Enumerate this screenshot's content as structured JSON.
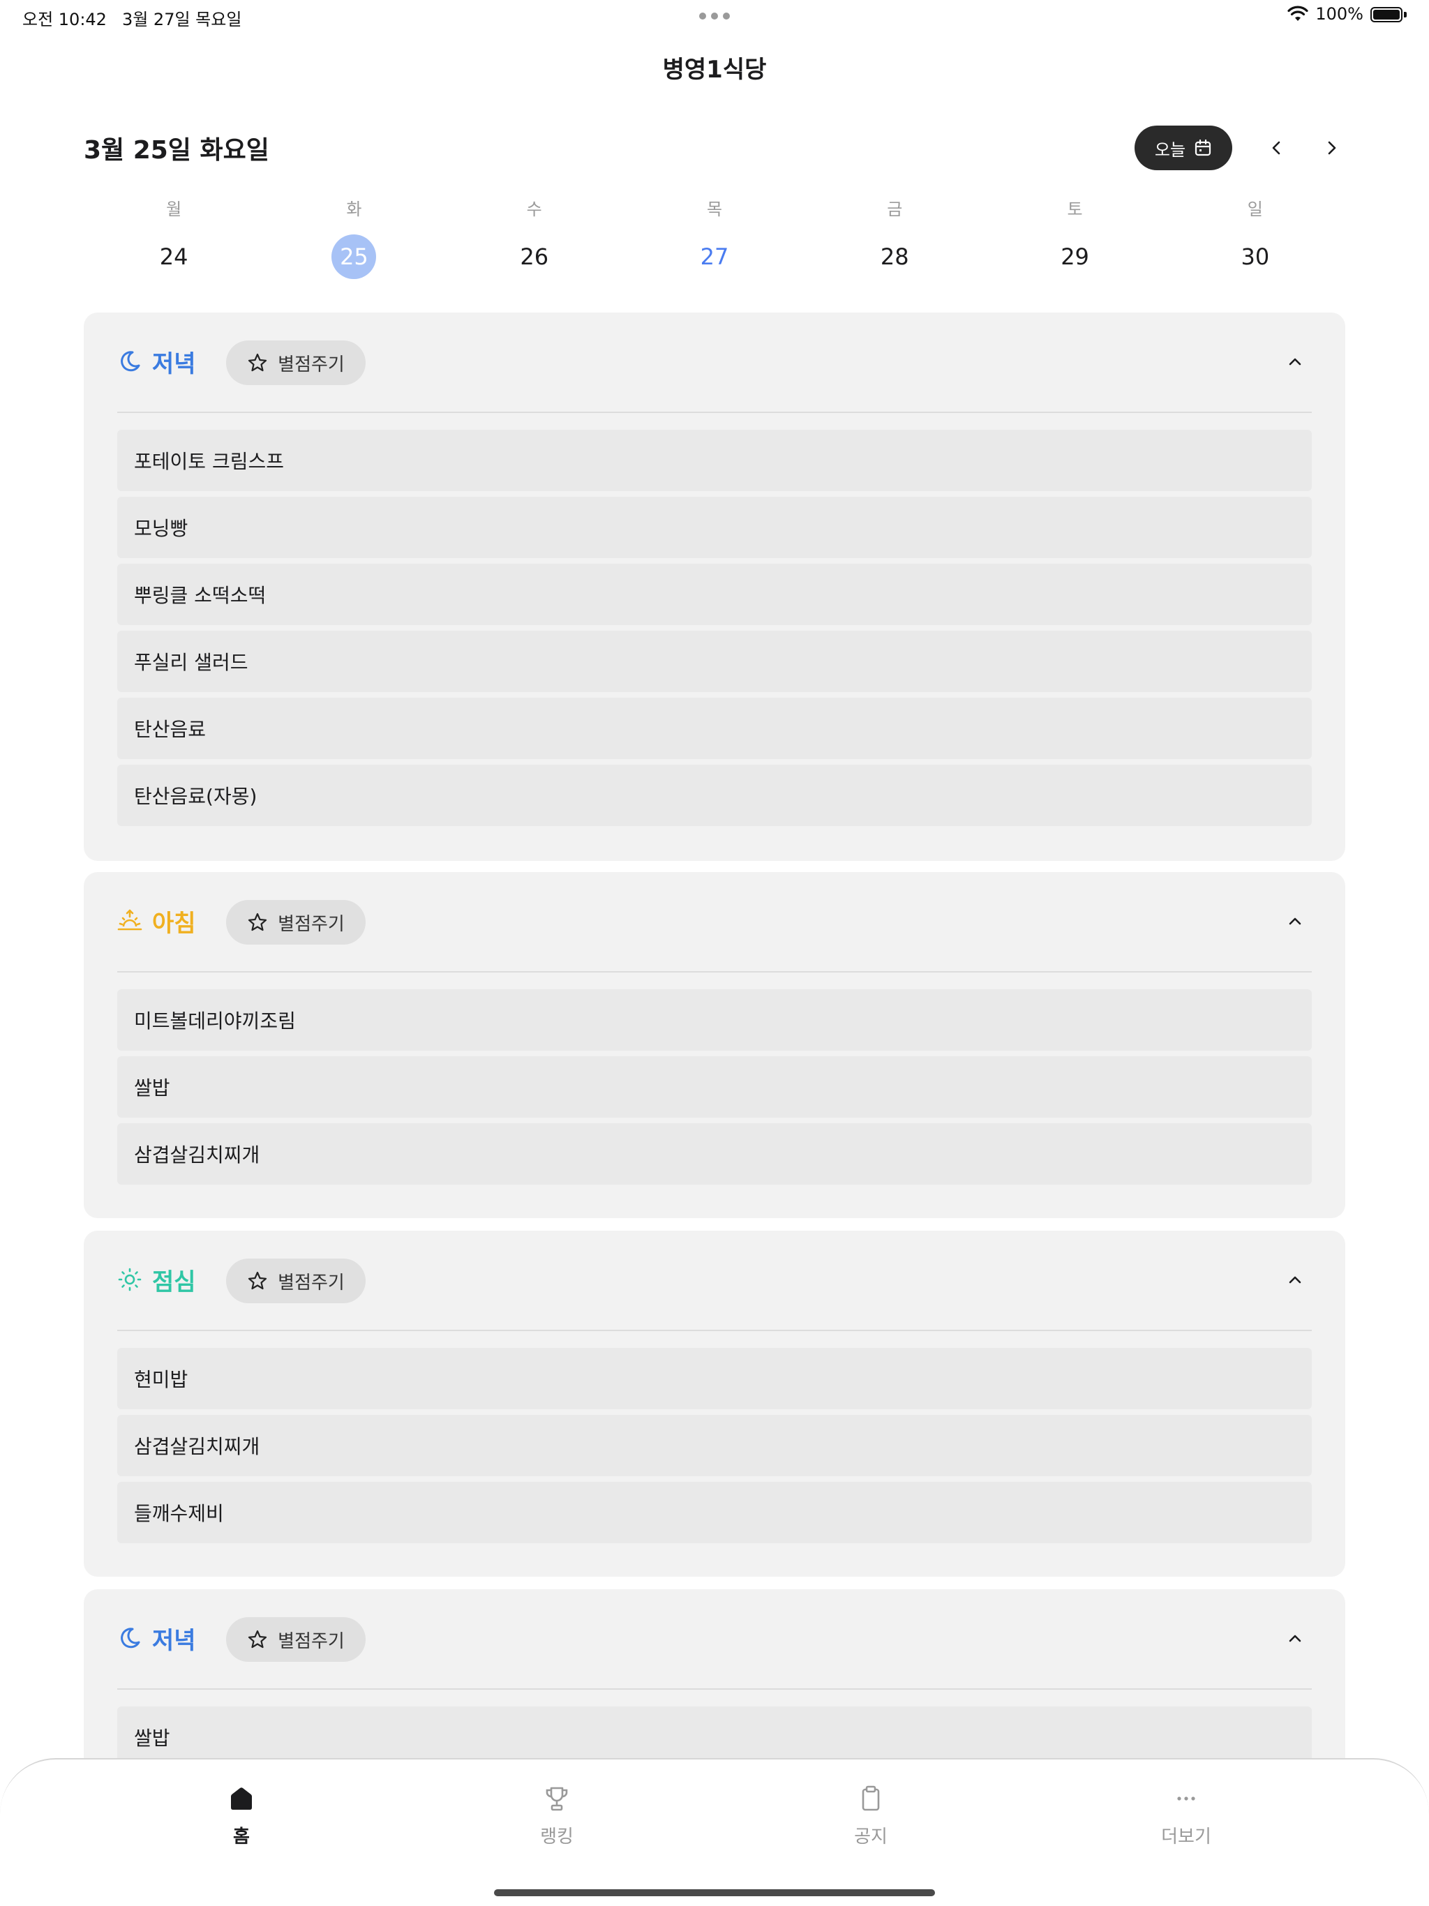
{
  "status": {
    "time": "오전 10:42",
    "date": "3월 27일 목요일",
    "battery": "100%"
  },
  "header": {
    "title": "병영1식당"
  },
  "date_nav": {
    "current_date": "3월 25일 화요일",
    "today_label": "오늘",
    "icons": {
      "calendar": "calendar-icon",
      "prev": "chevron-left-icon",
      "next": "chevron-right-icon"
    }
  },
  "week": [
    {
      "name": "월",
      "num": "24"
    },
    {
      "name": "화",
      "num": "25",
      "state": "selected"
    },
    {
      "name": "수",
      "num": "26"
    },
    {
      "name": "목",
      "num": "27",
      "state": "today"
    },
    {
      "name": "금",
      "num": "28"
    },
    {
      "name": "토",
      "num": "29"
    },
    {
      "name": "일",
      "num": "30"
    }
  ],
  "rate_label": "별점주기",
  "colors": {
    "dinner": "#3a7be0",
    "breakfast": "#f0b020",
    "lunch": "#2fc6a5",
    "selected_day": "#a7c2f6",
    "today_day": "#4a7cf0"
  },
  "meals": [
    {
      "label": "저녁",
      "icon": "moon-icon",
      "items": [
        "포테이토 크림스프",
        "모닝빵",
        "뿌링클 소떡소떡",
        "푸실리 샐러드",
        "탄산음료",
        "탄산음료(자몽)"
      ]
    },
    {
      "label": "아침",
      "icon": "sunrise-icon",
      "items": [
        "미트볼데리야끼조림",
        "쌀밥",
        "삼겹살김치찌개"
      ]
    },
    {
      "label": "점심",
      "icon": "sun-icon",
      "items": [
        "현미밥",
        "삼겹살김치찌개",
        "들깨수제비"
      ]
    },
    {
      "label": "저녁",
      "icon": "moon-icon",
      "items": [
        "쌀밥"
      ]
    }
  ],
  "tabs": [
    {
      "label": "홈",
      "icon": "home-icon",
      "active": true
    },
    {
      "label": "랭킹",
      "icon": "trophy-icon"
    },
    {
      "label": "공지",
      "icon": "clipboard-icon"
    },
    {
      "label": "더보기",
      "icon": "more-icon"
    }
  ]
}
